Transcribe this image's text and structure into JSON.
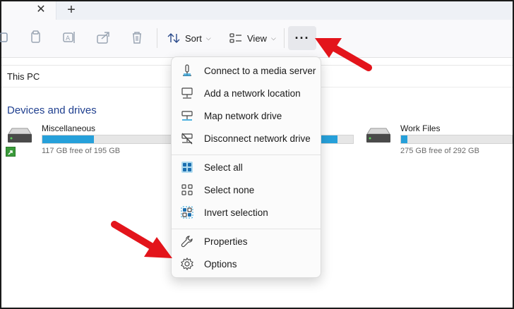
{
  "tabs": {
    "close_glyph": "✕",
    "new_tab_glyph": "+"
  },
  "toolbar": {
    "sort_label": "Sort",
    "view_label": "View",
    "more_glyph": "···"
  },
  "breadcrumb": {
    "label": "This PC"
  },
  "section": {
    "title": "Devices and drives"
  },
  "drives": [
    {
      "name": "Miscellaneous",
      "free": "117 GB free of 195 GB",
      "used_fraction": 0.4
    },
    {
      "name": "Work Files",
      "free": "275 GB free of 292 GB",
      "used_fraction": 0.06
    }
  ],
  "hidden_drive": {
    "used_fraction": 0.62
  },
  "menu": {
    "items": [
      {
        "label": "Connect to a media server",
        "icon": "media-server-icon"
      },
      {
        "label": "Add a network location",
        "icon": "network-location-icon"
      },
      {
        "label": "Map network drive",
        "icon": "map-drive-icon"
      },
      {
        "label": "Disconnect network drive",
        "icon": "disconnect-drive-icon"
      },
      {
        "label": "Select all",
        "icon": "select-all-icon"
      },
      {
        "label": "Select none",
        "icon": "select-none-icon"
      },
      {
        "label": "Invert selection",
        "icon": "invert-selection-icon"
      },
      {
        "label": "Properties",
        "icon": "wrench-icon"
      },
      {
        "label": "Options",
        "icon": "gear-icon"
      }
    ]
  },
  "colors": {
    "accent": "#26a0da",
    "section_title": "#1f3f8f",
    "annotation_arrow": "#e3141b"
  }
}
